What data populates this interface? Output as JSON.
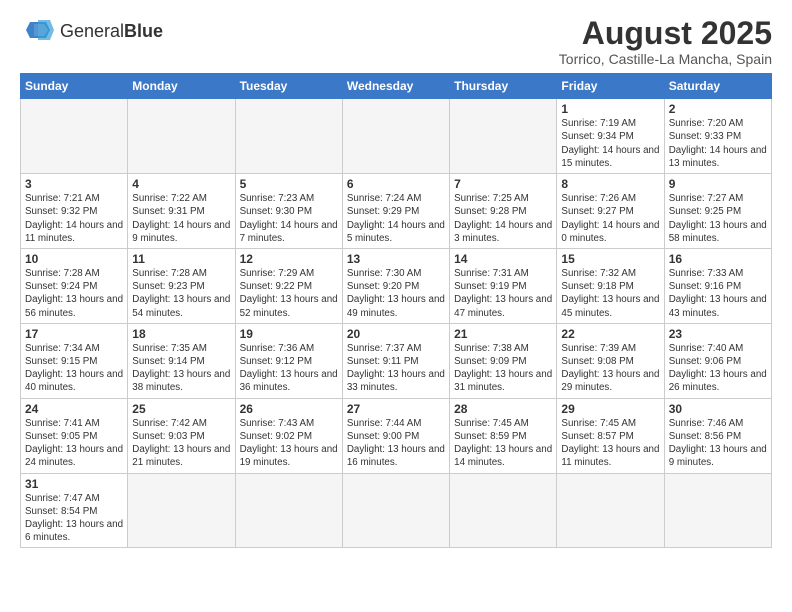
{
  "logo": {
    "text_normal": "General",
    "text_bold": "Blue"
  },
  "title": "August 2025",
  "subtitle": "Torrico, Castille-La Mancha, Spain",
  "days_of_week": [
    "Sunday",
    "Monday",
    "Tuesday",
    "Wednesday",
    "Thursday",
    "Friday",
    "Saturday"
  ],
  "weeks": [
    [
      {
        "day": "",
        "info": ""
      },
      {
        "day": "",
        "info": ""
      },
      {
        "day": "",
        "info": ""
      },
      {
        "day": "",
        "info": ""
      },
      {
        "day": "",
        "info": ""
      },
      {
        "day": "1",
        "info": "Sunrise: 7:19 AM\nSunset: 9:34 PM\nDaylight: 14 hours and 15 minutes."
      },
      {
        "day": "2",
        "info": "Sunrise: 7:20 AM\nSunset: 9:33 PM\nDaylight: 14 hours and 13 minutes."
      }
    ],
    [
      {
        "day": "3",
        "info": "Sunrise: 7:21 AM\nSunset: 9:32 PM\nDaylight: 14 hours and 11 minutes."
      },
      {
        "day": "4",
        "info": "Sunrise: 7:22 AM\nSunset: 9:31 PM\nDaylight: 14 hours and 9 minutes."
      },
      {
        "day": "5",
        "info": "Sunrise: 7:23 AM\nSunset: 9:30 PM\nDaylight: 14 hours and 7 minutes."
      },
      {
        "day": "6",
        "info": "Sunrise: 7:24 AM\nSunset: 9:29 PM\nDaylight: 14 hours and 5 minutes."
      },
      {
        "day": "7",
        "info": "Sunrise: 7:25 AM\nSunset: 9:28 PM\nDaylight: 14 hours and 3 minutes."
      },
      {
        "day": "8",
        "info": "Sunrise: 7:26 AM\nSunset: 9:27 PM\nDaylight: 14 hours and 0 minutes."
      },
      {
        "day": "9",
        "info": "Sunrise: 7:27 AM\nSunset: 9:25 PM\nDaylight: 13 hours and 58 minutes."
      }
    ],
    [
      {
        "day": "10",
        "info": "Sunrise: 7:28 AM\nSunset: 9:24 PM\nDaylight: 13 hours and 56 minutes."
      },
      {
        "day": "11",
        "info": "Sunrise: 7:28 AM\nSunset: 9:23 PM\nDaylight: 13 hours and 54 minutes."
      },
      {
        "day": "12",
        "info": "Sunrise: 7:29 AM\nSunset: 9:22 PM\nDaylight: 13 hours and 52 minutes."
      },
      {
        "day": "13",
        "info": "Sunrise: 7:30 AM\nSunset: 9:20 PM\nDaylight: 13 hours and 49 minutes."
      },
      {
        "day": "14",
        "info": "Sunrise: 7:31 AM\nSunset: 9:19 PM\nDaylight: 13 hours and 47 minutes."
      },
      {
        "day": "15",
        "info": "Sunrise: 7:32 AM\nSunset: 9:18 PM\nDaylight: 13 hours and 45 minutes."
      },
      {
        "day": "16",
        "info": "Sunrise: 7:33 AM\nSunset: 9:16 PM\nDaylight: 13 hours and 43 minutes."
      }
    ],
    [
      {
        "day": "17",
        "info": "Sunrise: 7:34 AM\nSunset: 9:15 PM\nDaylight: 13 hours and 40 minutes."
      },
      {
        "day": "18",
        "info": "Sunrise: 7:35 AM\nSunset: 9:14 PM\nDaylight: 13 hours and 38 minutes."
      },
      {
        "day": "19",
        "info": "Sunrise: 7:36 AM\nSunset: 9:12 PM\nDaylight: 13 hours and 36 minutes."
      },
      {
        "day": "20",
        "info": "Sunrise: 7:37 AM\nSunset: 9:11 PM\nDaylight: 13 hours and 33 minutes."
      },
      {
        "day": "21",
        "info": "Sunrise: 7:38 AM\nSunset: 9:09 PM\nDaylight: 13 hours and 31 minutes."
      },
      {
        "day": "22",
        "info": "Sunrise: 7:39 AM\nSunset: 9:08 PM\nDaylight: 13 hours and 29 minutes."
      },
      {
        "day": "23",
        "info": "Sunrise: 7:40 AM\nSunset: 9:06 PM\nDaylight: 13 hours and 26 minutes."
      }
    ],
    [
      {
        "day": "24",
        "info": "Sunrise: 7:41 AM\nSunset: 9:05 PM\nDaylight: 13 hours and 24 minutes."
      },
      {
        "day": "25",
        "info": "Sunrise: 7:42 AM\nSunset: 9:03 PM\nDaylight: 13 hours and 21 minutes."
      },
      {
        "day": "26",
        "info": "Sunrise: 7:43 AM\nSunset: 9:02 PM\nDaylight: 13 hours and 19 minutes."
      },
      {
        "day": "27",
        "info": "Sunrise: 7:44 AM\nSunset: 9:00 PM\nDaylight: 13 hours and 16 minutes."
      },
      {
        "day": "28",
        "info": "Sunrise: 7:45 AM\nSunset: 8:59 PM\nDaylight: 13 hours and 14 minutes."
      },
      {
        "day": "29",
        "info": "Sunrise: 7:45 AM\nSunset: 8:57 PM\nDaylight: 13 hours and 11 minutes."
      },
      {
        "day": "30",
        "info": "Sunrise: 7:46 AM\nSunset: 8:56 PM\nDaylight: 13 hours and 9 minutes."
      }
    ],
    [
      {
        "day": "31",
        "info": "Sunrise: 7:47 AM\nSunset: 8:54 PM\nDaylight: 13 hours and 6 minutes."
      },
      {
        "day": "",
        "info": ""
      },
      {
        "day": "",
        "info": ""
      },
      {
        "day": "",
        "info": ""
      },
      {
        "day": "",
        "info": ""
      },
      {
        "day": "",
        "info": ""
      },
      {
        "day": "",
        "info": ""
      }
    ]
  ]
}
